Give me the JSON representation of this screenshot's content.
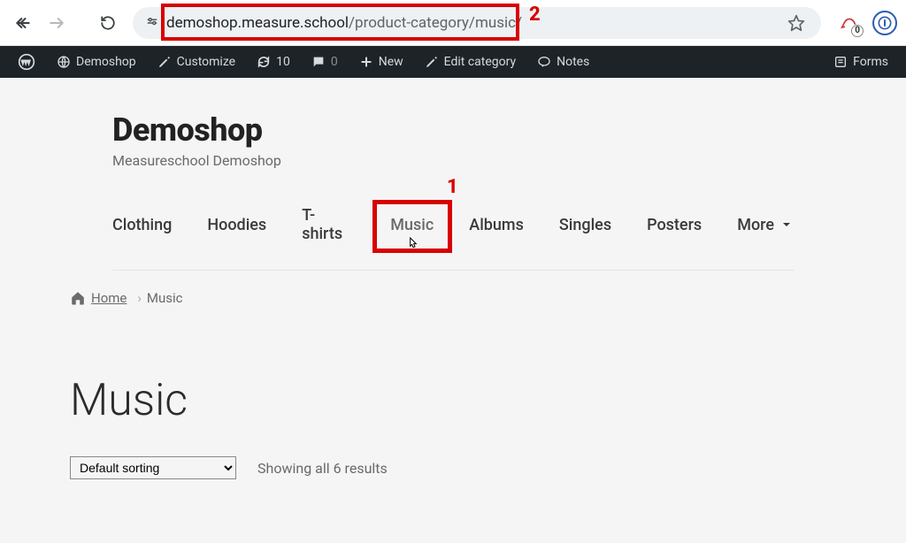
{
  "browser": {
    "url_host": "demoshop.measure.school",
    "url_path": "/product-category/music/"
  },
  "annotations": {
    "url_num": "2",
    "nav_num": "1"
  },
  "wp_bar": {
    "site_name": "Demoshop",
    "customize": "Customize",
    "updates": "10",
    "comments": "0",
    "new": "New",
    "edit": "Edit category",
    "notes": "Notes",
    "forms": "Forms"
  },
  "site": {
    "title": "Demoshop",
    "tagline": "Measureschool Demoshop"
  },
  "nav": {
    "items": [
      {
        "label": "Clothing"
      },
      {
        "label": "Hoodies"
      },
      {
        "label": "T-shirts"
      },
      {
        "label": "Music"
      },
      {
        "label": "Albums"
      },
      {
        "label": "Singles"
      },
      {
        "label": "Posters"
      },
      {
        "label": "More"
      }
    ]
  },
  "breadcrumb": {
    "home": "Home",
    "current": "Music"
  },
  "category": {
    "title": "Music",
    "sort_selected": "Default sorting",
    "results": "Showing all 6 results"
  }
}
